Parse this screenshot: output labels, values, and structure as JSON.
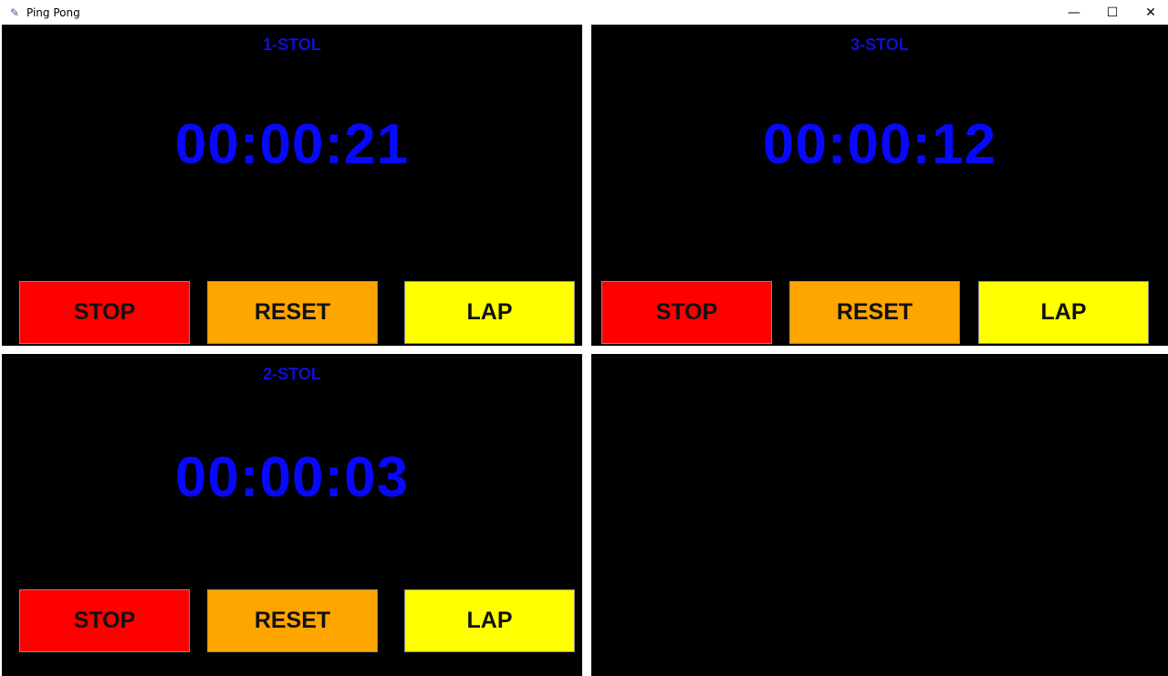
{
  "window": {
    "title": "Ping Pong",
    "minimize": "—",
    "maximize": "☐",
    "close": "✕"
  },
  "colors": {
    "stop": "#ff0000",
    "reset": "#ffa500",
    "lap": "#ffff00",
    "timer": "#0808ff"
  },
  "tables": [
    {
      "title": "1-STOL",
      "time": "00:00:21",
      "stop": "STOP",
      "reset": "RESET",
      "lap": "LAP"
    },
    {
      "title": "3-STOL",
      "time": "00:00:12",
      "stop": "STOP",
      "reset": "RESET",
      "lap": "LAP"
    },
    {
      "title": "2-STOL",
      "time": "00:00:03",
      "stop": "STOP",
      "reset": "RESET",
      "lap": "LAP"
    }
  ]
}
